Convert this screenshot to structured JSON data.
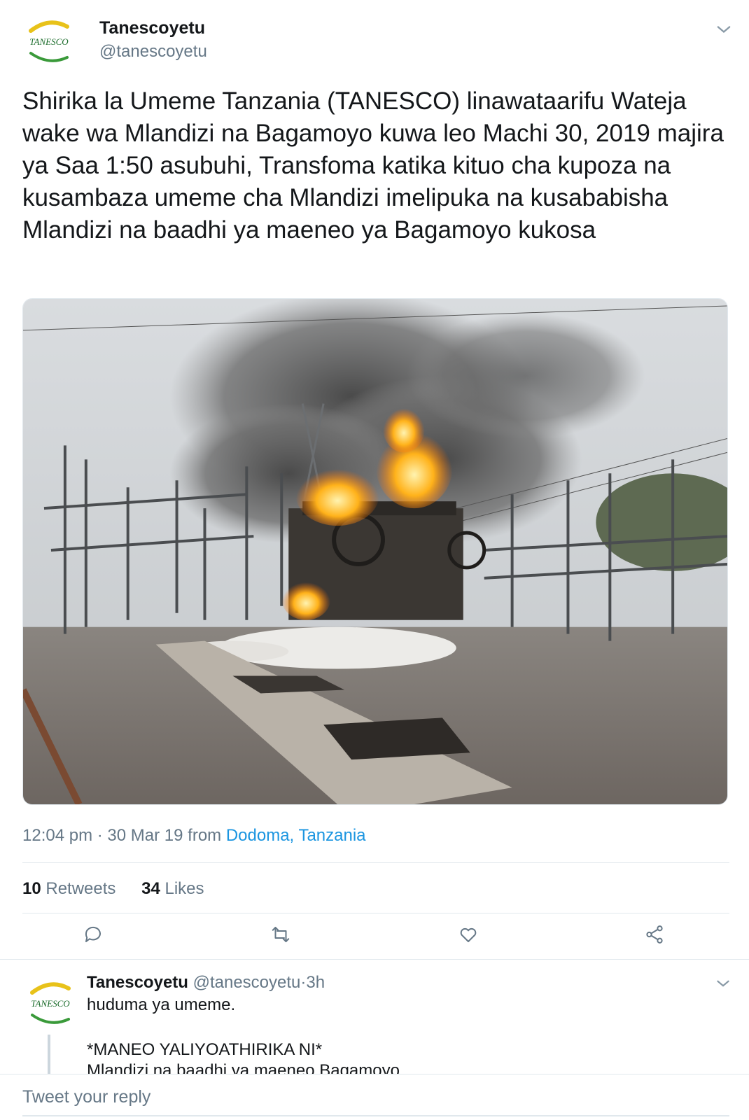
{
  "tweet": {
    "author_name": "Tanescoyetu",
    "author_handle": "@tanescoyetu",
    "avatar_logo_text": "TANESCO",
    "text": "Shirika la Umeme Tanzania (TANESCO) linawataarifu Wateja wake wa Mlandizi na Bagamoyo kuwa leo Machi 30, 2019 majira ya Saa 1:50 asubuhi, Transfoma katika kituo cha kupoza na kusambaza umeme cha Mlandizi imelipuka na kusababisha Mlandizi na baadhi ya maeneo ya Bagamoyo kukosa",
    "photo_description_icon": "burning-transformer-photo",
    "time": "12:04 pm",
    "separator": "·",
    "date": "30 Mar 19",
    "from_label": "from",
    "location": "Dodoma, Tanzania",
    "retweets_count": "10",
    "retweets_label": "Retweets",
    "likes_count": "34",
    "likes_label": "Likes"
  },
  "actions": [
    {
      "icon": "reply-icon"
    },
    {
      "icon": "retweet-icon"
    },
    {
      "icon": "like-icon"
    },
    {
      "icon": "share-icon"
    }
  ],
  "reply": {
    "author_name": "Tanescoyetu",
    "author_handle": "@tanescoyetu",
    "separator": "·",
    "time": "3h",
    "line1": "huduma ya umeme.",
    "line2": "*MANEO YALIYOATHIRIKA NI*",
    "line3": "Mlandizi na baadhi ya maeneo Bagamoyo"
  },
  "compose": {
    "placeholder": "Tweet your reply"
  },
  "colors": {
    "text": "#14171a",
    "secondary": "#657786",
    "link": "#1b95e0",
    "divider": "#e1e8ed",
    "logo_yellow": "#e8c21a",
    "logo_green": "#3a9a3a"
  }
}
